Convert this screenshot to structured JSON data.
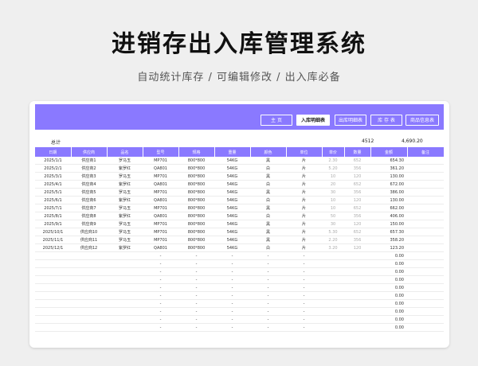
{
  "title": "进销存出入库管理系统",
  "subtitle": "自动统计库存 / 可编辑修改 / 出入库必备",
  "nav": [
    {
      "label": "主  页"
    },
    {
      "label": "入库明细表"
    },
    {
      "label": "出库明细表"
    },
    {
      "label": "库 存 表"
    },
    {
      "label": "商品信息表"
    }
  ],
  "summary": {
    "label": "总计",
    "qty_total": "4512",
    "amount_total": "4,690.20"
  },
  "columns": [
    "日期",
    "供应商",
    "品名",
    "型号",
    "规格",
    "重量",
    "颜色",
    "单位",
    "单价",
    "数量",
    "金额",
    "备注"
  ],
  "rows": [
    [
      "2025/1/1",
      "供应商1",
      "罗马玉",
      "MP701",
      "800*800",
      "54KG",
      "黑",
      "片",
      "2.30",
      "652",
      "654.30",
      ""
    ],
    [
      "2025/2/1",
      "供应商2",
      "紫罗红",
      "QA801",
      "800*800",
      "54KG",
      "白",
      "片",
      "5.20",
      "356",
      "361.20",
      ""
    ],
    [
      "2025/3/1",
      "供应商3",
      "罗马玉",
      "MP701",
      "800*800",
      "54KG",
      "黑",
      "片",
      "10",
      "120",
      "130.00",
      ""
    ],
    [
      "2025/4/1",
      "供应商4",
      "紫罗红",
      "QA801",
      "800*800",
      "54KG",
      "白",
      "片",
      "20",
      "652",
      "672.00",
      ""
    ],
    [
      "2025/5/1",
      "供应商5",
      "罗马玉",
      "MP701",
      "800*800",
      "54KG",
      "黑",
      "片",
      "30",
      "356",
      "386.00",
      ""
    ],
    [
      "2025/6/1",
      "供应商6",
      "紫罗红",
      "QA801",
      "800*800",
      "54KG",
      "白",
      "片",
      "10",
      "120",
      "130.00",
      ""
    ],
    [
      "2025/7/1",
      "供应商7",
      "罗马玉",
      "MP701",
      "800*800",
      "54KG",
      "黑",
      "片",
      "10",
      "652",
      "662.00",
      ""
    ],
    [
      "2025/8/1",
      "供应商8",
      "紫罗红",
      "QA801",
      "800*800",
      "54KG",
      "白",
      "片",
      "50",
      "356",
      "406.00",
      ""
    ],
    [
      "2025/9/1",
      "供应商9",
      "罗马玉",
      "MP701",
      "800*800",
      "54KG",
      "黑",
      "片",
      "30",
      "120",
      "150.00",
      ""
    ],
    [
      "2025/10/1",
      "供应商10",
      "罗马玉",
      "MP701",
      "800*800",
      "54KG",
      "黑",
      "片",
      "5.30",
      "652",
      "657.30",
      ""
    ],
    [
      "2025/11/1",
      "供应商11",
      "罗马玉",
      "MP701",
      "800*800",
      "54KG",
      "黑",
      "片",
      "2.20",
      "356",
      "358.20",
      ""
    ],
    [
      "2025/12/1",
      "供应商12",
      "紫罗红",
      "QA801",
      "800*800",
      "54KG",
      "白",
      "片",
      "3.20",
      "120",
      "123.20",
      ""
    ],
    [
      "",
      "",
      "",
      "-",
      "-",
      "-",
      "-",
      "-",
      "",
      "",
      "0.00",
      ""
    ],
    [
      "",
      "",
      "",
      "-",
      "-",
      "-",
      "-",
      "-",
      "",
      "",
      "0.00",
      ""
    ],
    [
      "",
      "",
      "",
      "-",
      "-",
      "-",
      "-",
      "-",
      "",
      "",
      "0.00",
      ""
    ],
    [
      "",
      "",
      "",
      "-",
      "-",
      "-",
      "-",
      "-",
      "",
      "",
      "0.00",
      ""
    ],
    [
      "",
      "",
      "",
      "-",
      "-",
      "-",
      "-",
      "-",
      "",
      "",
      "0.00",
      ""
    ],
    [
      "",
      "",
      "",
      "-",
      "-",
      "-",
      "-",
      "-",
      "",
      "",
      "0.00",
      ""
    ],
    [
      "",
      "",
      "",
      "-",
      "-",
      "-",
      "-",
      "-",
      "",
      "",
      "0.00",
      ""
    ],
    [
      "",
      "",
      "",
      "-",
      "-",
      "-",
      "-",
      "-",
      "",
      "",
      "0.00",
      ""
    ],
    [
      "",
      "",
      "",
      "-",
      "-",
      "-",
      "-",
      "-",
      "",
      "",
      "0.00",
      ""
    ],
    [
      "",
      "",
      "",
      "-",
      "-",
      "-",
      "-",
      "-",
      "",
      "",
      "0.00",
      ""
    ]
  ],
  "colors": {
    "accent": "#8a79ff"
  }
}
